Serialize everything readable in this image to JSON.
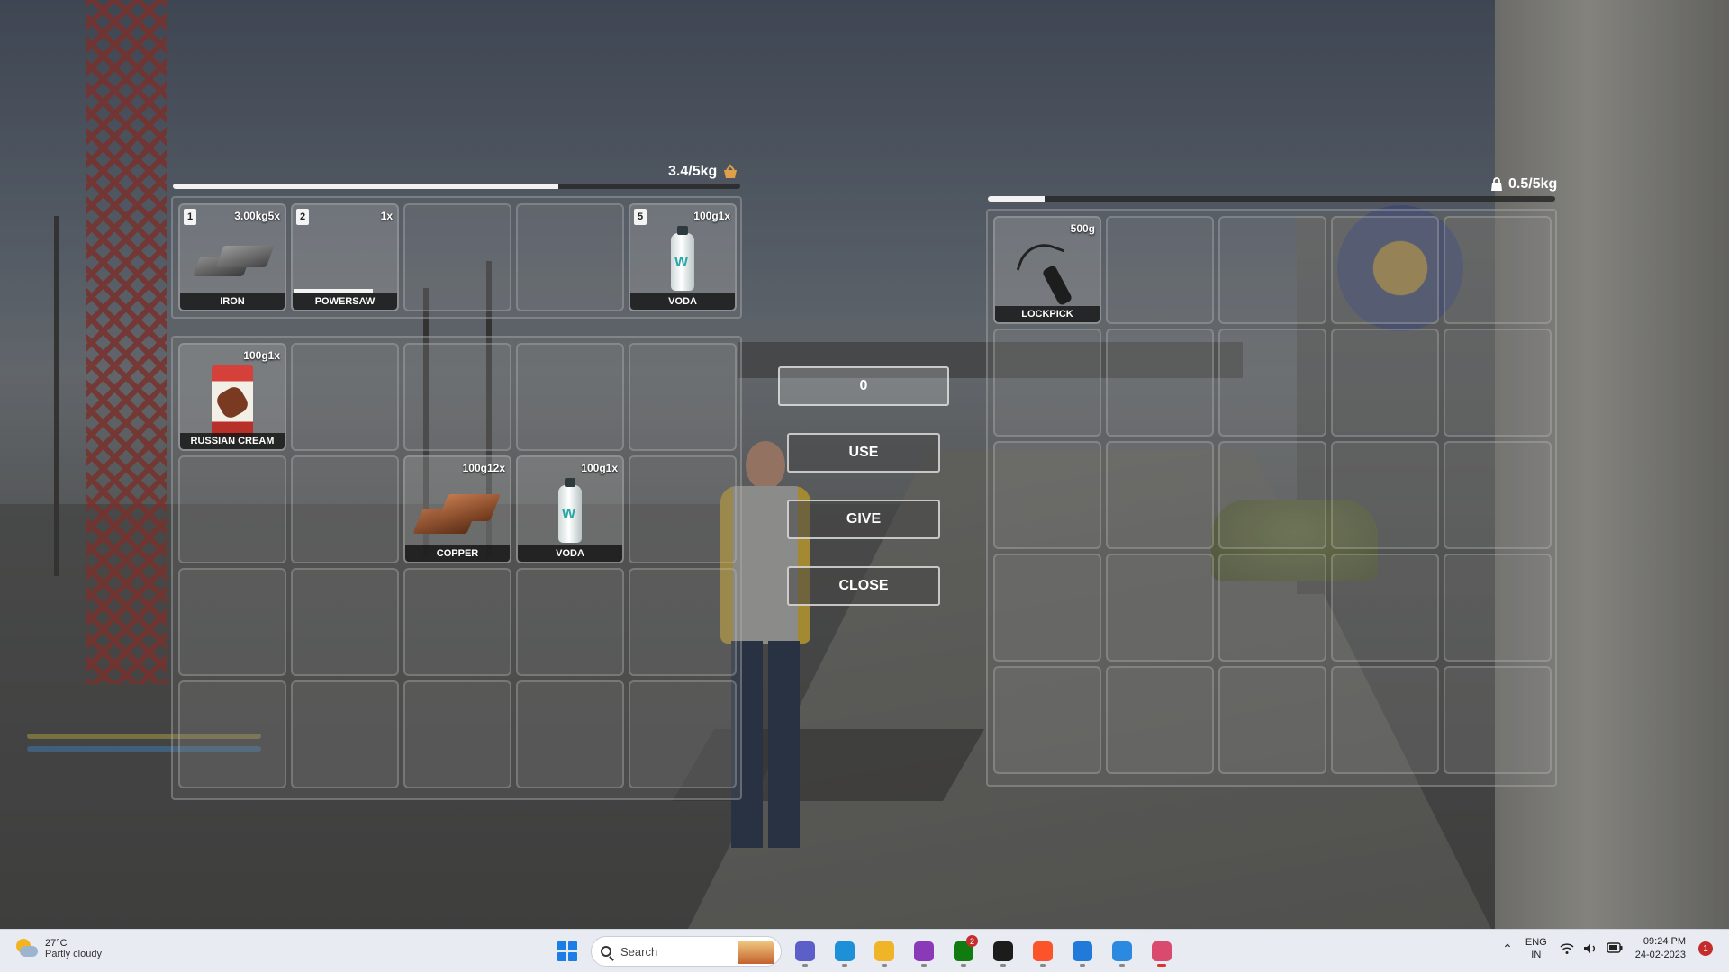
{
  "player_inventory": {
    "weight_text": "3.4/5kg",
    "weight_fraction": 0.68,
    "hotbar": [
      {
        "slot": "1",
        "meta": "3.00kg5x",
        "label": "IRON",
        "art": "iron"
      },
      {
        "slot": "2",
        "meta": "1x",
        "label": "POWERSAW",
        "art": "powersaw",
        "durability": 0.75
      },
      null,
      null,
      {
        "slot": "5",
        "meta": "100g1x",
        "label": "VODA",
        "art": "bottle"
      }
    ],
    "items": [
      {
        "meta": "100g1x",
        "label": "RUSSIAN CREAM",
        "art": "pack"
      },
      null,
      null,
      null,
      null,
      null,
      null,
      {
        "meta": "100g12x",
        "label": "COPPER",
        "art": "copper"
      },
      {
        "meta": "100g1x",
        "label": "VODA",
        "art": "bottle"
      },
      null,
      null,
      null,
      null,
      null,
      null,
      null,
      null,
      null,
      null,
      null
    ]
  },
  "other_inventory": {
    "weight_text": "0.5/5kg",
    "weight_fraction": 0.1,
    "items": [
      {
        "meta": "500g",
        "label": "LOCKPICK",
        "art": "lockpick"
      },
      null,
      null,
      null,
      null,
      null,
      null,
      null,
      null,
      null,
      null,
      null,
      null,
      null,
      null,
      null,
      null,
      null,
      null,
      null,
      null,
      null,
      null,
      null,
      null
    ]
  },
  "controls": {
    "amount_value": "0",
    "use_label": "USE",
    "give_label": "GIVE",
    "close_label": "CLOSE"
  },
  "taskbar": {
    "weather_temp": "27°C",
    "weather_desc": "Partly cloudy",
    "search_placeholder": "Search",
    "apps": [
      {
        "name": "meet-icon",
        "color": "#5b5fc7"
      },
      {
        "name": "edge-icon",
        "color": "#1e90d8"
      },
      {
        "name": "file-explorer-icon",
        "color": "#f0b429"
      },
      {
        "name": "app-purple-icon",
        "color": "#8a3ab9"
      },
      {
        "name": "xbox-icon",
        "color": "#107c10",
        "badge": "2"
      },
      {
        "name": "terminal-icon",
        "color": "#1c1c1c"
      },
      {
        "name": "brave-icon",
        "color": "#fb542b"
      },
      {
        "name": "vscode-icon",
        "color": "#1f7ad9"
      },
      {
        "name": "app-blue-icon",
        "color": "#2b8ae0"
      },
      {
        "name": "snipping-tool-icon",
        "color": "#d94a6e",
        "active": true
      }
    ],
    "lang_top": "ENG",
    "lang_bottom": "IN",
    "time": "09:24 PM",
    "date": "24-02-2023",
    "notifications": "1"
  }
}
